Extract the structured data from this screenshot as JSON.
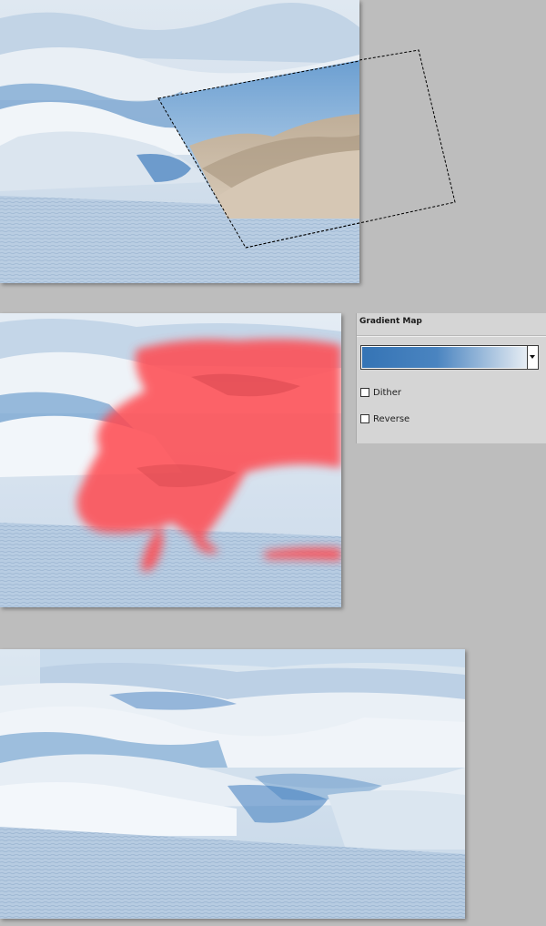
{
  "gradient_map_panel": {
    "title": "Gradient Map",
    "gradient": {
      "color_stops": [
        "#3574b5",
        "#4a84c0",
        "#e8eef4"
      ],
      "icon": "chevron-down-icon"
    },
    "options": [
      {
        "label": "Dither",
        "checked": false
      },
      {
        "label": "Reverse",
        "checked": false
      }
    ]
  },
  "canvas_steps": [
    {
      "description_color": "#c9d9e8",
      "overlay_color": "#ff4a50"
    }
  ],
  "colors": {
    "workspace_bg": "#bdbdbd",
    "panel_bg": "#d5d5d5",
    "mask_red": "#ff4a50",
    "dune_blue": "#4d86c4",
    "sand": "#cbb9a3"
  }
}
